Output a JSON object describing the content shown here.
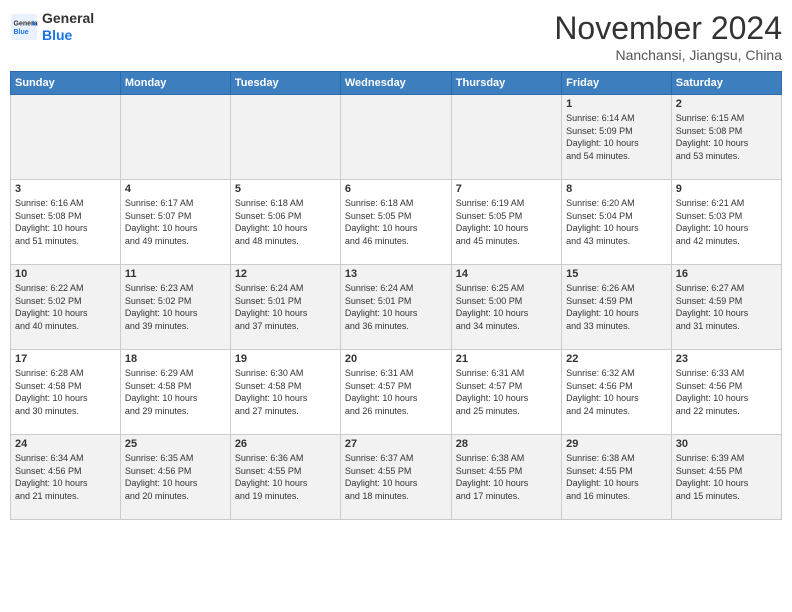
{
  "header": {
    "logo_general": "General",
    "logo_blue": "Blue",
    "month_title": "November 2024",
    "location": "Nanchansi, Jiangsu, China"
  },
  "weekdays": [
    "Sunday",
    "Monday",
    "Tuesday",
    "Wednesday",
    "Thursday",
    "Friday",
    "Saturday"
  ],
  "weeks": [
    [
      {
        "day": "",
        "info": ""
      },
      {
        "day": "",
        "info": ""
      },
      {
        "day": "",
        "info": ""
      },
      {
        "day": "",
        "info": ""
      },
      {
        "day": "",
        "info": ""
      },
      {
        "day": "1",
        "info": "Sunrise: 6:14 AM\nSunset: 5:09 PM\nDaylight: 10 hours\nand 54 minutes."
      },
      {
        "day": "2",
        "info": "Sunrise: 6:15 AM\nSunset: 5:08 PM\nDaylight: 10 hours\nand 53 minutes."
      }
    ],
    [
      {
        "day": "3",
        "info": "Sunrise: 6:16 AM\nSunset: 5:08 PM\nDaylight: 10 hours\nand 51 minutes."
      },
      {
        "day": "4",
        "info": "Sunrise: 6:17 AM\nSunset: 5:07 PM\nDaylight: 10 hours\nand 49 minutes."
      },
      {
        "day": "5",
        "info": "Sunrise: 6:18 AM\nSunset: 5:06 PM\nDaylight: 10 hours\nand 48 minutes."
      },
      {
        "day": "6",
        "info": "Sunrise: 6:18 AM\nSunset: 5:05 PM\nDaylight: 10 hours\nand 46 minutes."
      },
      {
        "day": "7",
        "info": "Sunrise: 6:19 AM\nSunset: 5:05 PM\nDaylight: 10 hours\nand 45 minutes."
      },
      {
        "day": "8",
        "info": "Sunrise: 6:20 AM\nSunset: 5:04 PM\nDaylight: 10 hours\nand 43 minutes."
      },
      {
        "day": "9",
        "info": "Sunrise: 6:21 AM\nSunset: 5:03 PM\nDaylight: 10 hours\nand 42 minutes."
      }
    ],
    [
      {
        "day": "10",
        "info": "Sunrise: 6:22 AM\nSunset: 5:02 PM\nDaylight: 10 hours\nand 40 minutes."
      },
      {
        "day": "11",
        "info": "Sunrise: 6:23 AM\nSunset: 5:02 PM\nDaylight: 10 hours\nand 39 minutes."
      },
      {
        "day": "12",
        "info": "Sunrise: 6:24 AM\nSunset: 5:01 PM\nDaylight: 10 hours\nand 37 minutes."
      },
      {
        "day": "13",
        "info": "Sunrise: 6:24 AM\nSunset: 5:01 PM\nDaylight: 10 hours\nand 36 minutes."
      },
      {
        "day": "14",
        "info": "Sunrise: 6:25 AM\nSunset: 5:00 PM\nDaylight: 10 hours\nand 34 minutes."
      },
      {
        "day": "15",
        "info": "Sunrise: 6:26 AM\nSunset: 4:59 PM\nDaylight: 10 hours\nand 33 minutes."
      },
      {
        "day": "16",
        "info": "Sunrise: 6:27 AM\nSunset: 4:59 PM\nDaylight: 10 hours\nand 31 minutes."
      }
    ],
    [
      {
        "day": "17",
        "info": "Sunrise: 6:28 AM\nSunset: 4:58 PM\nDaylight: 10 hours\nand 30 minutes."
      },
      {
        "day": "18",
        "info": "Sunrise: 6:29 AM\nSunset: 4:58 PM\nDaylight: 10 hours\nand 29 minutes."
      },
      {
        "day": "19",
        "info": "Sunrise: 6:30 AM\nSunset: 4:58 PM\nDaylight: 10 hours\nand 27 minutes."
      },
      {
        "day": "20",
        "info": "Sunrise: 6:31 AM\nSunset: 4:57 PM\nDaylight: 10 hours\nand 26 minutes."
      },
      {
        "day": "21",
        "info": "Sunrise: 6:31 AM\nSunset: 4:57 PM\nDaylight: 10 hours\nand 25 minutes."
      },
      {
        "day": "22",
        "info": "Sunrise: 6:32 AM\nSunset: 4:56 PM\nDaylight: 10 hours\nand 24 minutes."
      },
      {
        "day": "23",
        "info": "Sunrise: 6:33 AM\nSunset: 4:56 PM\nDaylight: 10 hours\nand 22 minutes."
      }
    ],
    [
      {
        "day": "24",
        "info": "Sunrise: 6:34 AM\nSunset: 4:56 PM\nDaylight: 10 hours\nand 21 minutes."
      },
      {
        "day": "25",
        "info": "Sunrise: 6:35 AM\nSunset: 4:56 PM\nDaylight: 10 hours\nand 20 minutes."
      },
      {
        "day": "26",
        "info": "Sunrise: 6:36 AM\nSunset: 4:55 PM\nDaylight: 10 hours\nand 19 minutes."
      },
      {
        "day": "27",
        "info": "Sunrise: 6:37 AM\nSunset: 4:55 PM\nDaylight: 10 hours\nand 18 minutes."
      },
      {
        "day": "28",
        "info": "Sunrise: 6:38 AM\nSunset: 4:55 PM\nDaylight: 10 hours\nand 17 minutes."
      },
      {
        "day": "29",
        "info": "Sunrise: 6:38 AM\nSunset: 4:55 PM\nDaylight: 10 hours\nand 16 minutes."
      },
      {
        "day": "30",
        "info": "Sunrise: 6:39 AM\nSunset: 4:55 PM\nDaylight: 10 hours\nand 15 minutes."
      }
    ]
  ]
}
